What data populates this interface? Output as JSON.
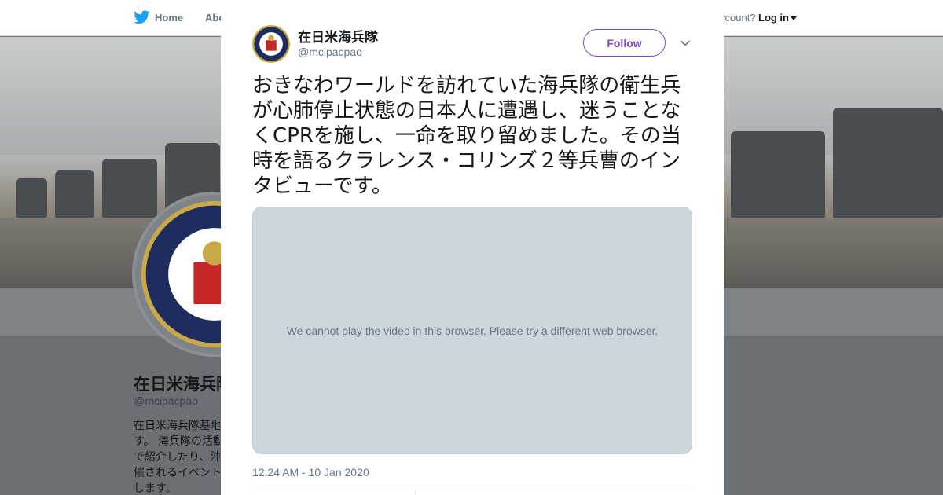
{
  "nav": {
    "home_label": "Home",
    "about_label": "Abo",
    "account_prompt": "ccount?",
    "login_label": "Log in"
  },
  "profile": {
    "name": "在日米海兵隊",
    "handle": "@mcipacpao",
    "bio_lines": [
      "在日米海兵隊基地",
      "す。 海兵隊の活動",
      "で紹介したり、沖",
      "催されるイベント",
      "します。"
    ]
  },
  "tweet": {
    "author_name": "在日米海兵隊",
    "author_handle": "@mcipacpao",
    "follow_label": "Follow",
    "text": "おきなわワールドを訪れていた海兵隊の衛生兵が心肺停止状態の日本人に遭遇し、迷うことなくCPRを施し、一命を取り留めました。その当時を語るクラレンス・コリンズ２等兵曹のインタビューです。",
    "video_message": "We cannot play the video in this browser. Please try a different web browser.",
    "timestamp": "12:24 AM - 10 Jan 2020"
  },
  "colors": {
    "twitter_blue": "#1da1f2",
    "follow_purple": "#794bc4",
    "overlay": "#6b7075"
  },
  "icons": {
    "logo": "twitter-bird-icon",
    "close": "close-icon",
    "more": "chevron-down-icon"
  }
}
